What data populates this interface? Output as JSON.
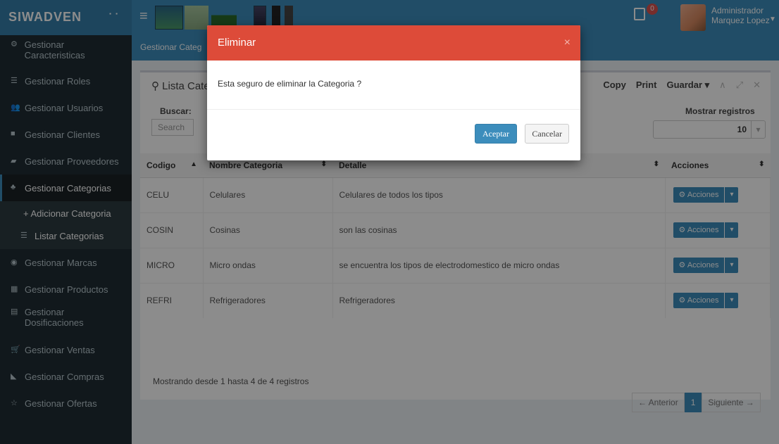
{
  "app": {
    "logo": "SIWADVEN"
  },
  "header": {
    "user_line1": "Administrador",
    "user_line2": "Marquez Lopez",
    "notification_count": "0"
  },
  "sidebar": {
    "items": [
      {
        "label": "Gestionar Caracteristicas",
        "icon": "cogs-icon"
      },
      {
        "label": "Gestionar Roles",
        "icon": "list-icon"
      },
      {
        "label": "Gestionar Usuarios",
        "icon": "users-icon"
      },
      {
        "label": "Gestionar Clientes",
        "icon": "folder-icon"
      },
      {
        "label": "Gestionar Proveedores",
        "icon": "truck-icon"
      },
      {
        "label": "Gestionar Categorias",
        "icon": "sitemap-icon"
      },
      {
        "label": "+ Adicionar Categoria",
        "icon": ""
      },
      {
        "label": "Listar Categorias",
        "icon": "list-icon"
      },
      {
        "label": "Gestionar Marcas",
        "icon": "circle-icon"
      },
      {
        "label": "Gestionar Productos",
        "icon": "box-icon"
      },
      {
        "label": "Gestionar Dosificaciones",
        "icon": "file-icon"
      },
      {
        "label": "Gestionar Ventas",
        "icon": "cart-icon"
      },
      {
        "label": "Gestionar Compras",
        "icon": "bag-icon"
      },
      {
        "label": "Gestionar Ofertas",
        "icon": "star-icon"
      }
    ]
  },
  "breadcrumb": "Gestionar Categ",
  "box": {
    "title": "Lista Cate",
    "tools": [
      "Copy",
      "Print",
      "Guardar ▾"
    ],
    "search_label": "Buscar:",
    "search_placeholder": "Search",
    "length_label": "Mostrar registros",
    "length_value": "10"
  },
  "table": {
    "headers": [
      "Codigo",
      "Nombre Categoria",
      "Detalle",
      "Acciones"
    ],
    "action_label": "Acciones",
    "rows": [
      {
        "codigo": "CELU",
        "nombre": "Celulares",
        "detalle": "Celulares de todos los tipos"
      },
      {
        "codigo": "COSIN",
        "nombre": "Cosinas",
        "detalle": "son las cosinas"
      },
      {
        "codigo": "MICRO",
        "nombre": "Micro ondas",
        "detalle": "se encuentra los tipos de electrodomestico de micro ondas"
      },
      {
        "codigo": "REFRI",
        "nombre": "Refrigeradores",
        "detalle": "Refrigeradores"
      }
    ]
  },
  "info": "Mostrando desde 1 hasta 4 de 4 registros",
  "pagination": {
    "prev": "← Anterior",
    "page": "1",
    "next": "Siguiente →"
  },
  "modal": {
    "title": "Eliminar",
    "message": "Esta seguro de eliminar la Categoria ?",
    "confirm": "Aceptar",
    "cancel": "Cancelar",
    "header_color": "#dd4b39"
  }
}
